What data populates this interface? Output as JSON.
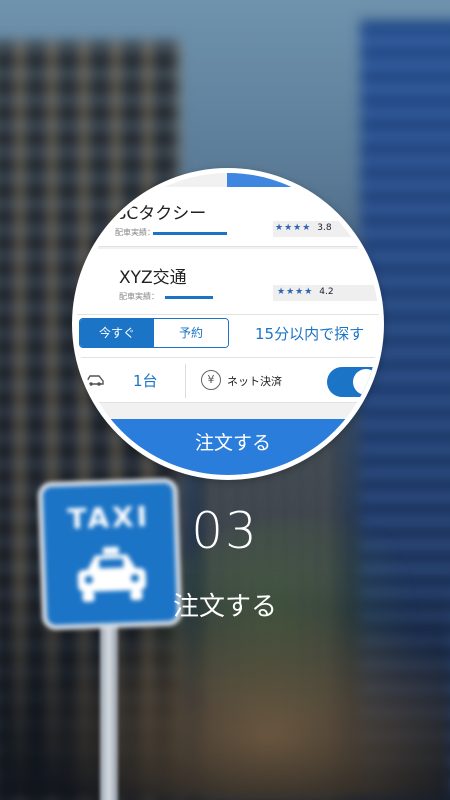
{
  "background": {
    "sign_text": "TAXI"
  },
  "magnified": {
    "companies": [
      {
        "name": "BCタクシー",
        "record_label": "配車実績：",
        "rating": "3.8",
        "stars": "★★★★"
      },
      {
        "name": "XYZ交通",
        "record_label": "配車実績：",
        "rating": "4.2",
        "stars": "★★★★"
      }
    ],
    "mode": {
      "now_label": "今すぐ",
      "reserve_label": "予約",
      "search_label": "15分以内で探す"
    },
    "count_label": "1台",
    "payment_label": "ネット決済",
    "yen_glyph": "¥",
    "order_button": "注文する"
  },
  "step": {
    "number": "03",
    "title": "注文する"
  },
  "colors": {
    "accent": "#1b74c6",
    "button": "#2b7ddc"
  }
}
